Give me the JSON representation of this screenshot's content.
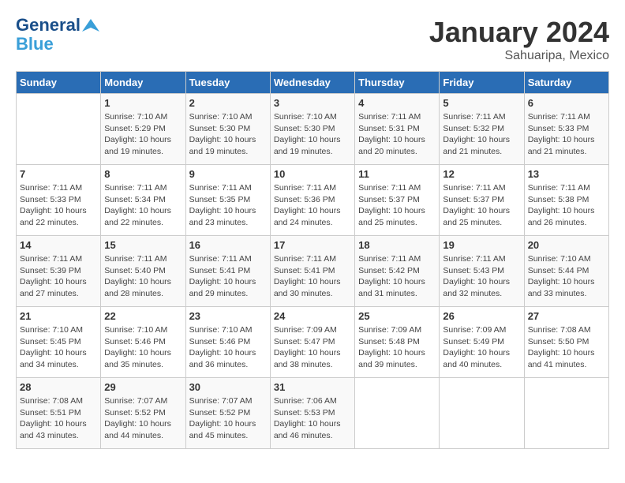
{
  "logo": {
    "line1": "General",
    "line2": "Blue"
  },
  "title": "January 2024",
  "subtitle": "Sahuaripa, Mexico",
  "days_of_week": [
    "Sunday",
    "Monday",
    "Tuesday",
    "Wednesday",
    "Thursday",
    "Friday",
    "Saturday"
  ],
  "weeks": [
    [
      {
        "day": "",
        "info": ""
      },
      {
        "day": "1",
        "info": "Sunrise: 7:10 AM\nSunset: 5:29 PM\nDaylight: 10 hours\nand 19 minutes."
      },
      {
        "day": "2",
        "info": "Sunrise: 7:10 AM\nSunset: 5:30 PM\nDaylight: 10 hours\nand 19 minutes."
      },
      {
        "day": "3",
        "info": "Sunrise: 7:10 AM\nSunset: 5:30 PM\nDaylight: 10 hours\nand 19 minutes."
      },
      {
        "day": "4",
        "info": "Sunrise: 7:11 AM\nSunset: 5:31 PM\nDaylight: 10 hours\nand 20 minutes."
      },
      {
        "day": "5",
        "info": "Sunrise: 7:11 AM\nSunset: 5:32 PM\nDaylight: 10 hours\nand 21 minutes."
      },
      {
        "day": "6",
        "info": "Sunrise: 7:11 AM\nSunset: 5:33 PM\nDaylight: 10 hours\nand 21 minutes."
      }
    ],
    [
      {
        "day": "7",
        "info": "Sunrise: 7:11 AM\nSunset: 5:33 PM\nDaylight: 10 hours\nand 22 minutes."
      },
      {
        "day": "8",
        "info": "Sunrise: 7:11 AM\nSunset: 5:34 PM\nDaylight: 10 hours\nand 22 minutes."
      },
      {
        "day": "9",
        "info": "Sunrise: 7:11 AM\nSunset: 5:35 PM\nDaylight: 10 hours\nand 23 minutes."
      },
      {
        "day": "10",
        "info": "Sunrise: 7:11 AM\nSunset: 5:36 PM\nDaylight: 10 hours\nand 24 minutes."
      },
      {
        "day": "11",
        "info": "Sunrise: 7:11 AM\nSunset: 5:37 PM\nDaylight: 10 hours\nand 25 minutes."
      },
      {
        "day": "12",
        "info": "Sunrise: 7:11 AM\nSunset: 5:37 PM\nDaylight: 10 hours\nand 25 minutes."
      },
      {
        "day": "13",
        "info": "Sunrise: 7:11 AM\nSunset: 5:38 PM\nDaylight: 10 hours\nand 26 minutes."
      }
    ],
    [
      {
        "day": "14",
        "info": "Sunrise: 7:11 AM\nSunset: 5:39 PM\nDaylight: 10 hours\nand 27 minutes."
      },
      {
        "day": "15",
        "info": "Sunrise: 7:11 AM\nSunset: 5:40 PM\nDaylight: 10 hours\nand 28 minutes."
      },
      {
        "day": "16",
        "info": "Sunrise: 7:11 AM\nSunset: 5:41 PM\nDaylight: 10 hours\nand 29 minutes."
      },
      {
        "day": "17",
        "info": "Sunrise: 7:11 AM\nSunset: 5:41 PM\nDaylight: 10 hours\nand 30 minutes."
      },
      {
        "day": "18",
        "info": "Sunrise: 7:11 AM\nSunset: 5:42 PM\nDaylight: 10 hours\nand 31 minutes."
      },
      {
        "day": "19",
        "info": "Sunrise: 7:11 AM\nSunset: 5:43 PM\nDaylight: 10 hours\nand 32 minutes."
      },
      {
        "day": "20",
        "info": "Sunrise: 7:10 AM\nSunset: 5:44 PM\nDaylight: 10 hours\nand 33 minutes."
      }
    ],
    [
      {
        "day": "21",
        "info": "Sunrise: 7:10 AM\nSunset: 5:45 PM\nDaylight: 10 hours\nand 34 minutes."
      },
      {
        "day": "22",
        "info": "Sunrise: 7:10 AM\nSunset: 5:46 PM\nDaylight: 10 hours\nand 35 minutes."
      },
      {
        "day": "23",
        "info": "Sunrise: 7:10 AM\nSunset: 5:46 PM\nDaylight: 10 hours\nand 36 minutes."
      },
      {
        "day": "24",
        "info": "Sunrise: 7:09 AM\nSunset: 5:47 PM\nDaylight: 10 hours\nand 38 minutes."
      },
      {
        "day": "25",
        "info": "Sunrise: 7:09 AM\nSunset: 5:48 PM\nDaylight: 10 hours\nand 39 minutes."
      },
      {
        "day": "26",
        "info": "Sunrise: 7:09 AM\nSunset: 5:49 PM\nDaylight: 10 hours\nand 40 minutes."
      },
      {
        "day": "27",
        "info": "Sunrise: 7:08 AM\nSunset: 5:50 PM\nDaylight: 10 hours\nand 41 minutes."
      }
    ],
    [
      {
        "day": "28",
        "info": "Sunrise: 7:08 AM\nSunset: 5:51 PM\nDaylight: 10 hours\nand 43 minutes."
      },
      {
        "day": "29",
        "info": "Sunrise: 7:07 AM\nSunset: 5:52 PM\nDaylight: 10 hours\nand 44 minutes."
      },
      {
        "day": "30",
        "info": "Sunrise: 7:07 AM\nSunset: 5:52 PM\nDaylight: 10 hours\nand 45 minutes."
      },
      {
        "day": "31",
        "info": "Sunrise: 7:06 AM\nSunset: 5:53 PM\nDaylight: 10 hours\nand 46 minutes."
      },
      {
        "day": "",
        "info": ""
      },
      {
        "day": "",
        "info": ""
      },
      {
        "day": "",
        "info": ""
      }
    ]
  ]
}
